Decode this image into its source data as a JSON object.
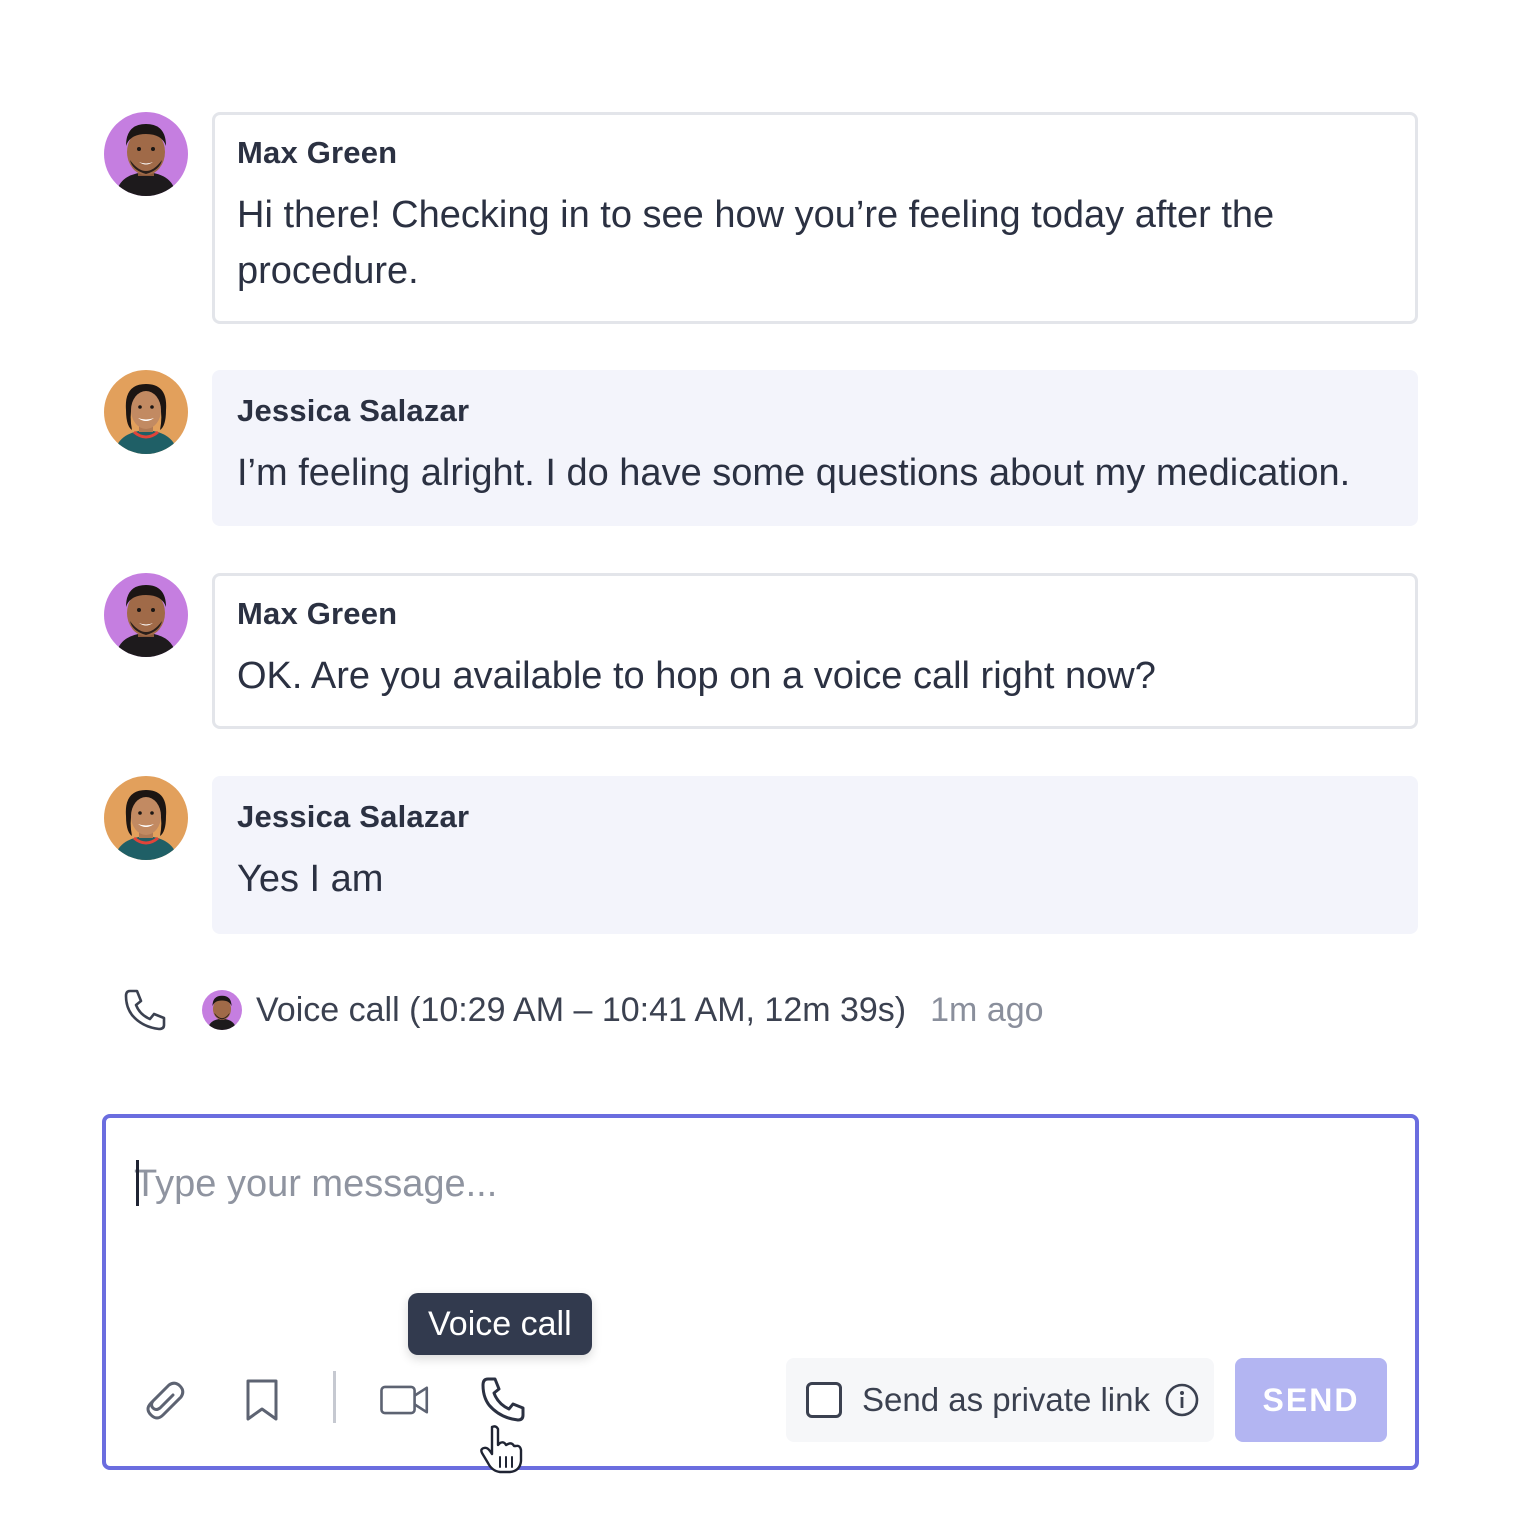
{
  "messages": [
    {
      "sender": "Max Green",
      "text": "Hi there! Checking in to see how you’re feeling today after the procedure.",
      "avatar": "max-green-avatar"
    },
    {
      "sender": "Jessica Salazar",
      "text": "I’m feeling alright. I do have some questions about my medication.",
      "avatar": "jessica-salazar-avatar"
    },
    {
      "sender": "Max Green",
      "text": "OK. Are you available to hop on a voice call right now?",
      "avatar": "max-green-avatar"
    },
    {
      "sender": "Jessica Salazar",
      "text": "Yes I am",
      "avatar": "jessica-salazar-avatar"
    }
  ],
  "call_log": {
    "icon": "phone-icon",
    "text": "Voice call (10:29 AM – 10:41 AM, 12m 39s)",
    "time": "1m ago"
  },
  "composer": {
    "placeholder": "Type your message...",
    "tooltip": "Voice call",
    "private_link_label": "Send as private link",
    "private_link_checked": false,
    "send_label": "SEND",
    "icons": [
      "paperclip-icon",
      "bookmark-icon",
      "video-camera-icon",
      "phone-icon",
      "info-icon",
      "hand-pointer-icon"
    ]
  },
  "colors": {
    "accent": "#6b6ddf",
    "send_disabled": "#b3b5f2",
    "incoming_bubble": "#f3f4fb",
    "outgoing_border": "#e3e5ea",
    "tooltip_bg": "#323a4e",
    "max_avatar_bg": "#c57ee0",
    "jessica_avatar_bg": "#e2a05c"
  }
}
